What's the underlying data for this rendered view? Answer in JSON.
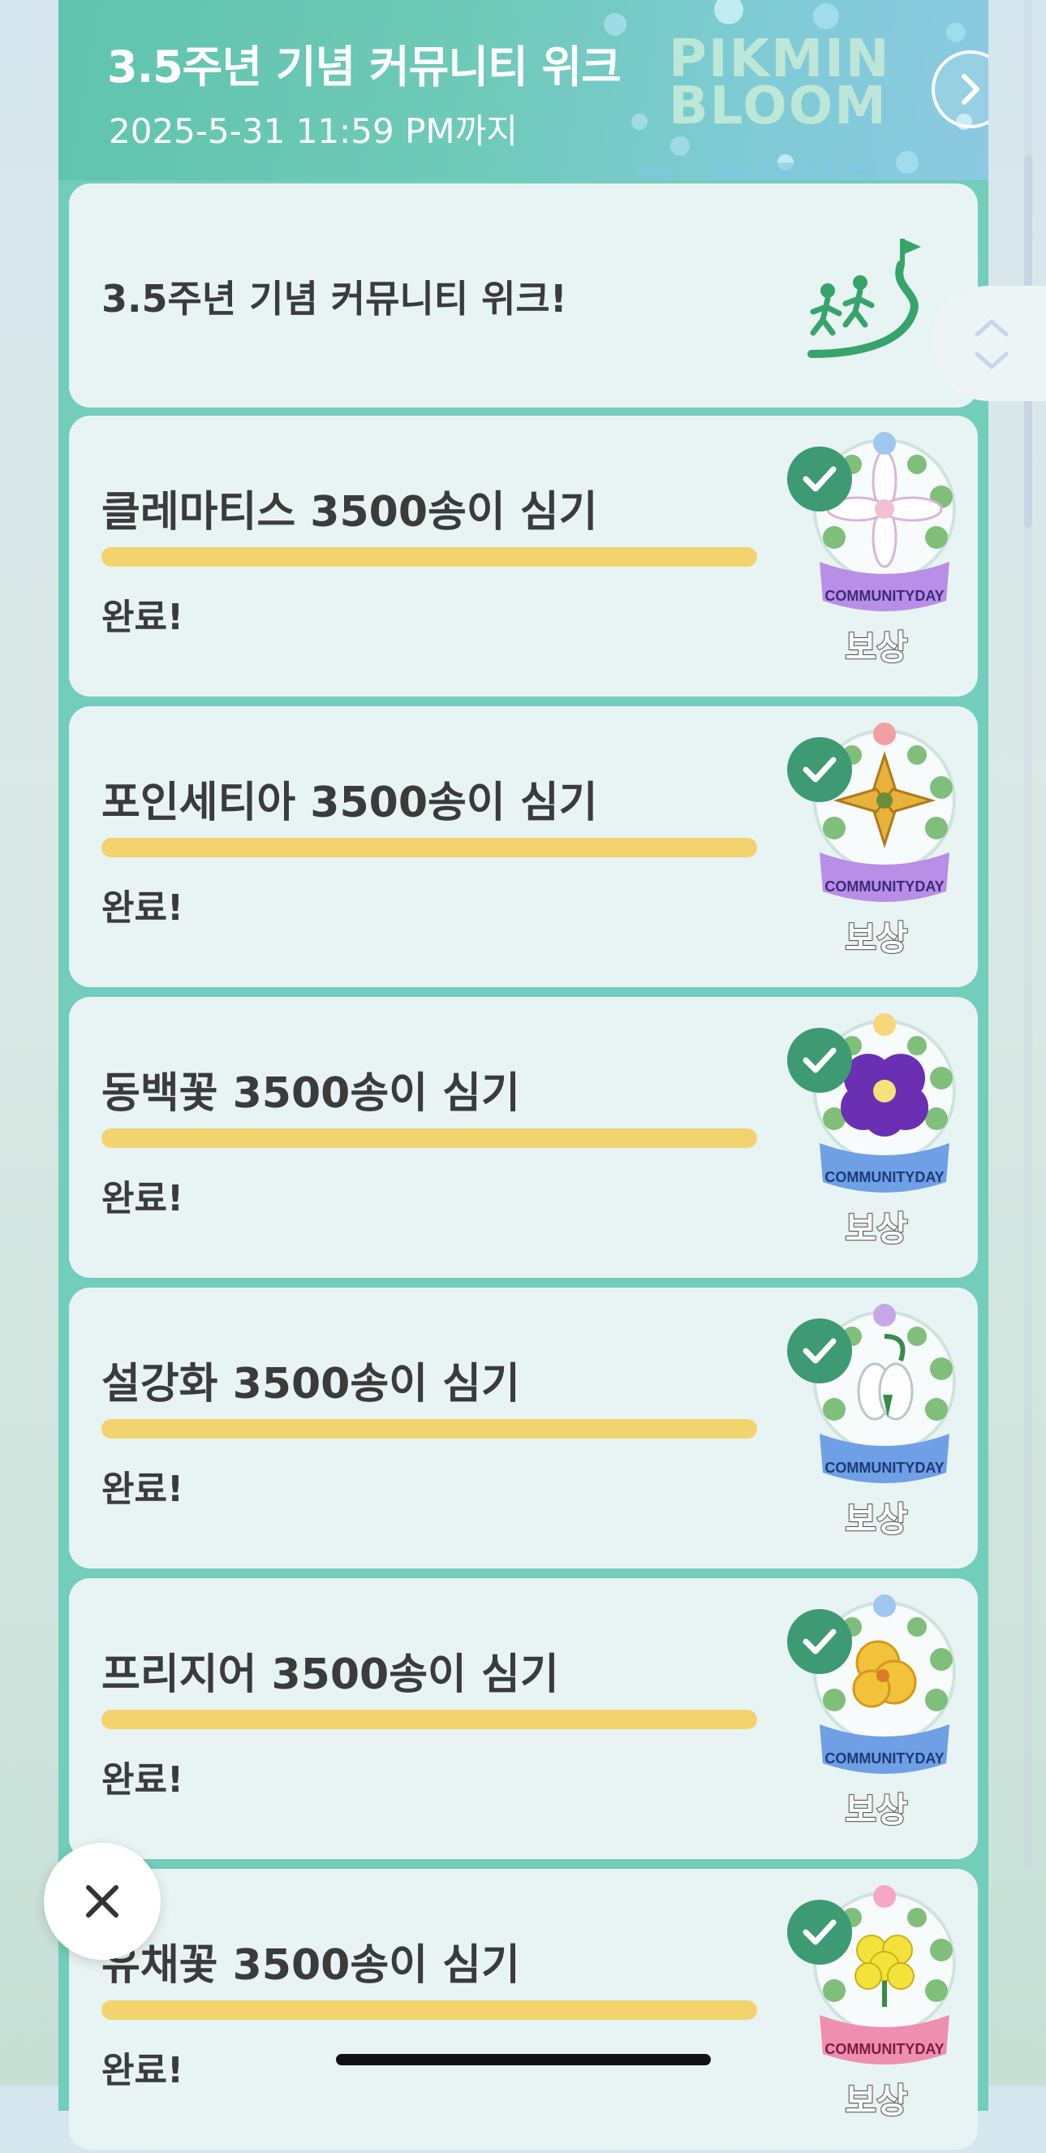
{
  "header": {
    "title": "3.5주년 기념 커뮤니티 위크",
    "deadline": "2025-5-31 11:59 PM까지",
    "banner_logo_lines": [
      "PIKMIN",
      "BLOOM"
    ],
    "banner_text": "3.5주년",
    "next_icon": "chevron-right-icon"
  },
  "intro": {
    "text": "3.5주년 기념 커뮤니티 위크!",
    "icon": "running-people-flag-icon"
  },
  "tasks": [
    {
      "title": "클레마티스 3500송이 심기",
      "status": "완료!",
      "reward_label": "보상",
      "badge_text": "COMMUNITYDAY",
      "progress": 1.0,
      "flower_color": "#ffffff",
      "ribbon_color": "#b98ee6"
    },
    {
      "title": "포인세티아 3500송이 심기",
      "status": "완료!",
      "reward_label": "보상",
      "badge_text": "COMMUNITYDAY",
      "progress": 1.0,
      "flower_color": "#e8b23a",
      "ribbon_color": "#b98ee6"
    },
    {
      "title": "동백꽃 3500송이 심기",
      "status": "완료!",
      "reward_label": "보상",
      "badge_text": "COMMUNITYDAY",
      "progress": 1.0,
      "flower_color": "#6a2fb3",
      "ribbon_color": "#6fa0e6"
    },
    {
      "title": "설강화 3500송이 심기",
      "status": "완료!",
      "reward_label": "보상",
      "badge_text": "COMMUNITYDAY",
      "progress": 1.0,
      "flower_color": "#f4f7f7",
      "ribbon_color": "#6fa0e6"
    },
    {
      "title": "프리지어 3500송이 심기",
      "status": "완료!",
      "reward_label": "보상",
      "badge_text": "COMMUNITYDAY",
      "progress": 1.0,
      "flower_color": "#f2c23a",
      "ribbon_color": "#6fa0e6"
    },
    {
      "title": "유채꽃 3500송이 심기",
      "status": "완료!",
      "reward_label": "보상",
      "badge_text": "COMMUNITYDAY",
      "progress": 1.0,
      "flower_color": "#f3e23a",
      "ribbon_color": "#ef8fb0"
    }
  ],
  "close_icon": "close-icon",
  "colors": {
    "accent": "#72cdbb",
    "progress": "#f2d36e",
    "check": "#3d9a72"
  }
}
